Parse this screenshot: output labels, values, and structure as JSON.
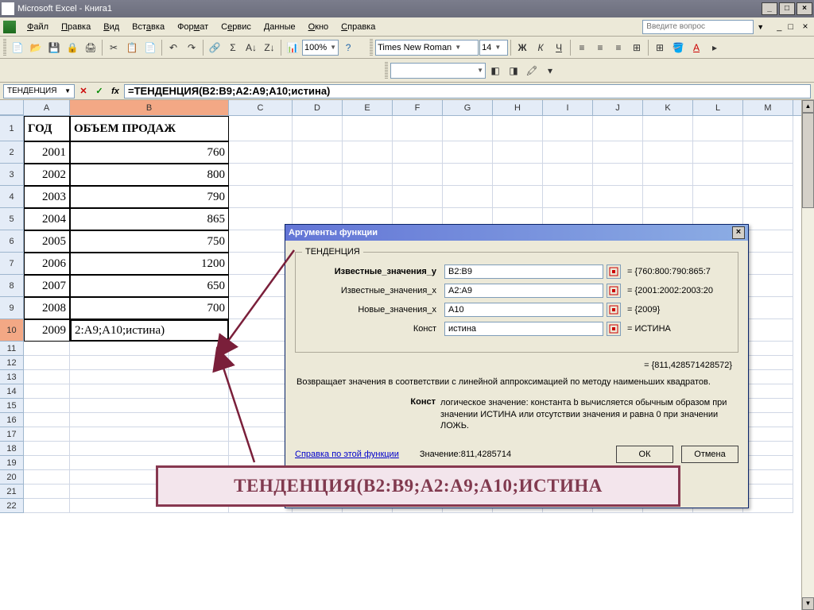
{
  "window": {
    "title": "Microsoft Excel - Книга1"
  },
  "menu": {
    "items": [
      "Файл",
      "Правка",
      "Вид",
      "Вставка",
      "Формат",
      "Сервис",
      "Данные",
      "Окно",
      "Справка"
    ],
    "question_placeholder": "Введите вопрос"
  },
  "toolbar": {
    "zoom": "100%",
    "font_name": "Times New Roman",
    "font_size": "14"
  },
  "formula_bar": {
    "name_box": "ТЕНДЕНЦИЯ",
    "formula": "=ТЕНДЕНЦИЯ(B2:B9;A2:A9;A10;истина)"
  },
  "columns": [
    "A",
    "B",
    "C",
    "D",
    "E",
    "F",
    "G",
    "H",
    "I",
    "J",
    "K",
    "L",
    "M"
  ],
  "headers": {
    "A": "ГОД",
    "B": "ОБЪЕМ ПРОДАЖ"
  },
  "rows": [
    {
      "n": 1
    },
    {
      "n": 2,
      "A": "2001",
      "B": "760"
    },
    {
      "n": 3,
      "A": "2002",
      "B": "800"
    },
    {
      "n": 4,
      "A": "2003",
      "B": "790"
    },
    {
      "n": 5,
      "A": "2004",
      "B": "865"
    },
    {
      "n": 6,
      "A": "2005",
      "B": "750"
    },
    {
      "n": 7,
      "A": "2006",
      "B": "1200"
    },
    {
      "n": 8,
      "A": "2007",
      "B": "650"
    },
    {
      "n": 9,
      "A": "2008",
      "B": "700"
    },
    {
      "n": 10,
      "A": "2009",
      "B": "2:A9;A10;истина)"
    }
  ],
  "dialog": {
    "title": "Аргументы функции",
    "legend": "ТЕНДЕНЦИЯ",
    "args": [
      {
        "label": "Известные_значения_y",
        "value": "B2:B9",
        "result": "= {760:800:790:865:7",
        "bold": true
      },
      {
        "label": "Известные_значения_x",
        "value": "A2:A9",
        "result": "= {2001:2002:2003:20",
        "bold": false
      },
      {
        "label": "Новые_значения_x",
        "value": "A10",
        "result": "= {2009}",
        "bold": false
      },
      {
        "label": "Конст",
        "value": "истина",
        "result": "= ИСТИНА",
        "bold": false
      }
    ],
    "calc_result": "= {811,428571428572}",
    "description": "Возвращает значения в соответствии с линейной аппроксимацией по методу наименьших квадратов.",
    "param_name": "Конст",
    "param_desc": "логическое значение: константа b вычисляется обычным образом при значении ИСТИНА или отсутствии значения и равна 0 при значении ЛОЖЬ.",
    "help_link": "Справка по этой функции",
    "value_label": "Значение:811,4285714",
    "ok": "ОК",
    "cancel": "Отмена"
  },
  "callout": "ТЕНДЕНЦИЯ(B2:B9;A2:A9;A10;ИСТИНА"
}
